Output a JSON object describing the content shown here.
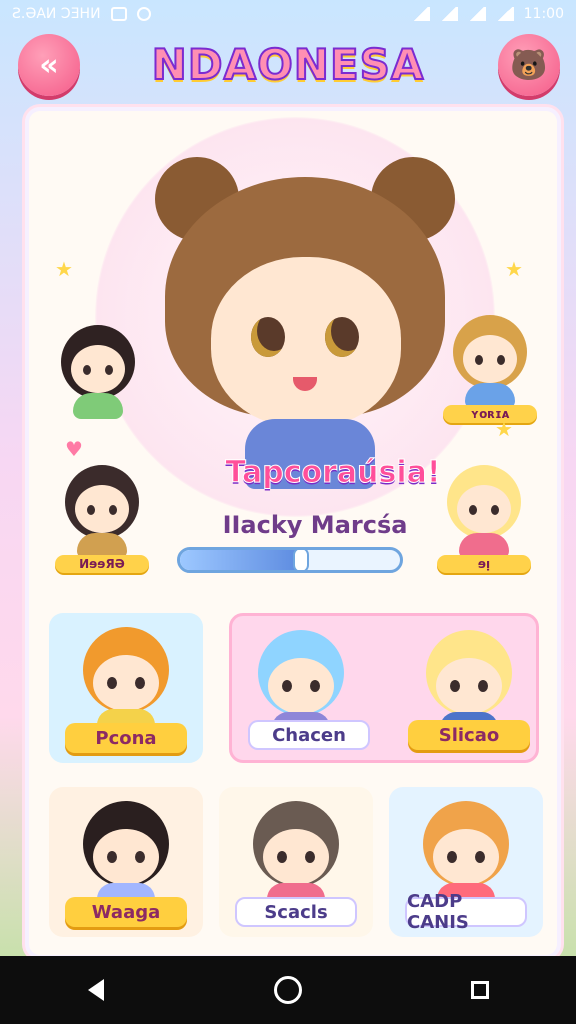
{
  "status_bar": {
    "left_text": "Ƨ.ƏAИ ƆƎHИ",
    "time": "11:00",
    "icons": [
      "sim-icon",
      "clock-icon",
      "cast-icon",
      "wifi-icon",
      "signal-icon",
      "battery-icon"
    ]
  },
  "header": {
    "title": "NDAONESA",
    "back_icon": "double-chevron-left-icon",
    "profile_icon": "bear-face-icon"
  },
  "hero": {
    "title": "Tapcoraúsia!",
    "name": "IIacky Marcśa",
    "progress": 0.55
  },
  "mini_characters": [
    {
      "label": ""
    },
    {
      "label": "ʏᴏʀɪᴀ"
    },
    {
      "label": "ИɘɘЯӘ"
    },
    {
      "label": "ɘᴉ"
    }
  ],
  "tiles": [
    {
      "label": "Pcona",
      "style": "yellow",
      "head_color": "#f19a2d",
      "body_color": "#f4d24a"
    },
    {
      "label": "Chacen",
      "style": "white",
      "head_color": "#8fd4ff",
      "body_color": "#8e86d8"
    },
    {
      "label": "Slicao",
      "style": "yellow",
      "head_color": "#ffe58a",
      "body_color": "#4c74c9"
    },
    {
      "label": "Waaga",
      "style": "yellow",
      "head_color": "#2a1f1f",
      "body_color": "#a2b6ff"
    },
    {
      "label": "Scacls",
      "style": "white",
      "head_color": "#6a5b52",
      "body_color": "#f06d8d"
    },
    {
      "label": "CADP CANIS",
      "style": "white",
      "head_color": "#f0a34a",
      "body_color": "#ff6a7b"
    }
  ],
  "nav": {
    "back_icon": "nav-back-icon",
    "home_icon": "nav-home-icon",
    "recents_icon": "nav-recents-icon"
  },
  "colors": {
    "accent_pink": "#f45a88",
    "accent_yellow": "#ffcf3f",
    "accent_purple": "#7b2bd0"
  }
}
